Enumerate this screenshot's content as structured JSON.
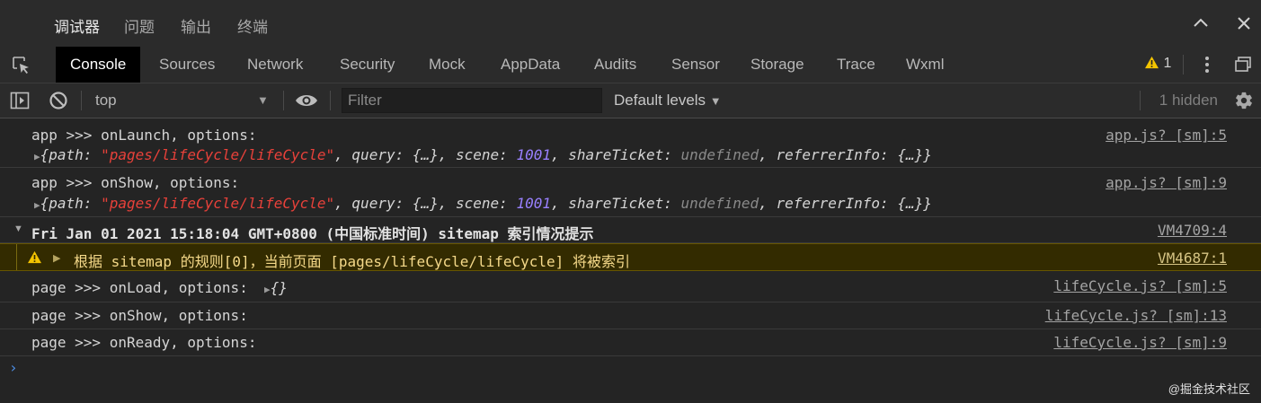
{
  "top_tabs": [
    "调试器",
    "问题",
    "输出",
    "终端"
  ],
  "top_active": "调试器",
  "panel_tabs": [
    "Console",
    "Sources",
    "Network",
    "Security",
    "Mock",
    "AppData",
    "Audits",
    "Sensor",
    "Storage",
    "Trace",
    "Wxml"
  ],
  "panel_active": "Console",
  "warning_count": "1",
  "toolbar": {
    "context": "top",
    "filter_placeholder": "Filter",
    "levels": "Default levels",
    "hidden": "1 hidden"
  },
  "messages": [
    {
      "text": "app >>> onLaunch, options:",
      "object": {
        "path": "\"pages/lifeCycle/lifeCycle\"",
        "scene": "1001",
        "shareTicket": "undefined"
      },
      "source": "app.js? [sm]:5"
    },
    {
      "text": "app >>> onShow, options:",
      "object": {
        "path": "\"pages/lifeCycle/lifeCycle\"",
        "scene": "1001",
        "shareTicket": "undefined"
      },
      "source": "app.js? [sm]:9"
    },
    {
      "text": "Fri Jan 01 2021 15:18:04 GMT+0800 (中国标准时间) sitemap 索引情况提示",
      "source": "VM4709:4"
    },
    {
      "text": "根据 sitemap 的规则[0]，当前页面 [pages/lifeCycle/lifeCycle] 将被索引",
      "source": "VM4687:1"
    },
    {
      "text": "page >>> onLoad, options:",
      "object_text": "{}",
      "source": "lifeCycle.js? [sm]:5"
    },
    {
      "text": "page >>> onShow, options:",
      "source": "lifeCycle.js? [sm]:13"
    },
    {
      "text": "page >>> onReady, options:",
      "source": "lifeCycle.js? [sm]:9"
    }
  ],
  "watermark": "@掘金技术社区",
  "colors": {
    "string": "#e8413a",
    "number": "#9980ff",
    "warning_bg": "#332b00",
    "accent": "#4d8fe6"
  }
}
